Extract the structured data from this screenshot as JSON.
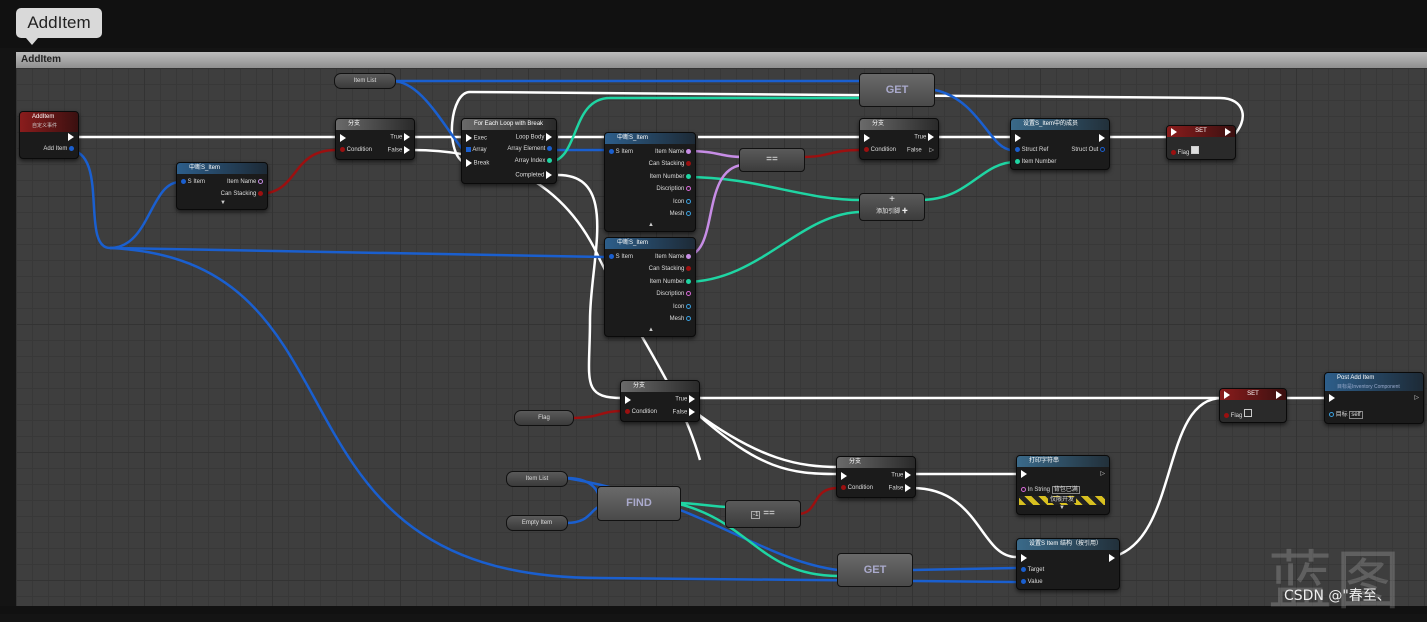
{
  "tab": {
    "title": "AddItem"
  },
  "graph": {
    "title": "AddItem"
  },
  "nodes": {
    "event": {
      "title": "AddItem",
      "sub": "自定义事件",
      "pin": "Add Item"
    },
    "break1": {
      "title": "中断S_Item",
      "in": "S Item",
      "out1": "Item Name",
      "out2": "Can Stacking"
    },
    "branch1": {
      "title": "分支",
      "cond": "Condition",
      "t": "True",
      "f": "False"
    },
    "itemlist1": {
      "label": "Item List"
    },
    "foreach": {
      "title": "For Each Loop with Break",
      "exec": "Exec",
      "array": "Array",
      "brk": "Break",
      "body": "Loop Body",
      "elem": "Array Element",
      "idx": "Array Index",
      "done": "Completed"
    },
    "break2": {
      "title": "中断S_Item",
      "in": "S Item",
      "p1": "Item Name",
      "p2": "Can Stacking",
      "p3": "Item Number",
      "p4": "Discription",
      "p5": "Icon",
      "p6": "Mesh"
    },
    "break3": {
      "title": "中断S_Item",
      "in": "S Item",
      "p1": "Item Name",
      "p2": "Can Stacking",
      "p3": "Item Number",
      "p4": "Discription",
      "p5": "Icon",
      "p6": "Mesh"
    },
    "eq1": {
      "label": "=="
    },
    "get1": {
      "label": "GET"
    },
    "branch2": {
      "title": "分支",
      "cond": "Condition",
      "t": "True",
      "f": "False"
    },
    "add": {
      "label": "+",
      "pin": "添加引脚"
    },
    "setmember": {
      "title": "设置S_Item中的成员",
      "p1": "Struct Ref",
      "p2": "Item Number",
      "out": "Struct Out"
    },
    "set1": {
      "title": "SET",
      "pin": "Flag"
    },
    "flag": {
      "label": "Flag"
    },
    "branch3": {
      "title": "分支",
      "cond": "Condition",
      "t": "True",
      "f": "False"
    },
    "set2": {
      "title": "SET",
      "pin": "Flag"
    },
    "postadd": {
      "title": "Post Add Item",
      "sub": "目标是Inventory Component",
      "pin": "目标",
      "val": "self"
    },
    "itemlist2": {
      "label": "Item List"
    },
    "emptyitem": {
      "label": "Empty Item"
    },
    "find": {
      "label": "FIND"
    },
    "eq2": {
      "label": "==",
      "val": "-1"
    },
    "branch4": {
      "title": "分支",
      "cond": "Condition",
      "t": "True",
      "f": "False"
    },
    "print": {
      "title": "打印字符串",
      "pin": "In String",
      "val": "背包已满",
      "dev": "仅限开发"
    },
    "setitem": {
      "title": "设置S Item 结构（按引用）",
      "p1": "Target",
      "p2": "Value"
    },
    "get2": {
      "label": "GET"
    }
  },
  "watermark": "蓝图",
  "credit": "CSDN @\"春至、"
}
